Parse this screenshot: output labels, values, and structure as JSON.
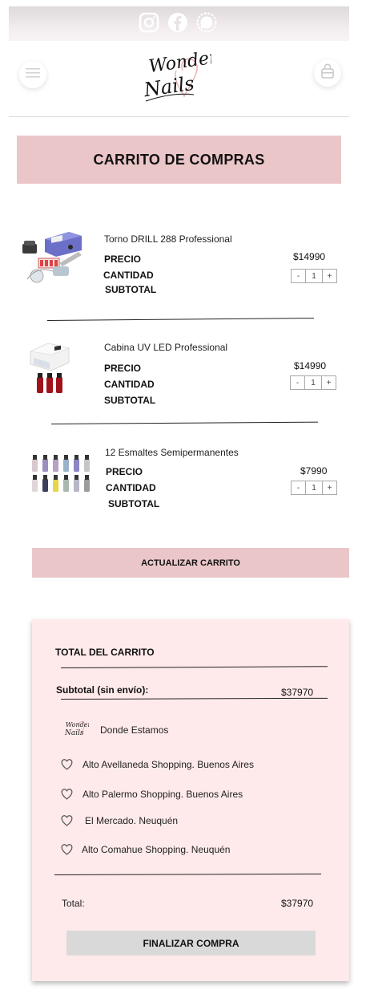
{
  "social": {
    "icons": [
      "instagram-icon",
      "facebook-icon",
      "signal-icon"
    ],
    "bar_color": "#ded9da"
  },
  "header": {
    "logo_line1": "Wonder",
    "logo_line2": "Nails",
    "menu_icon": "hamburger-icon",
    "cart_icon": "shopping-bag-icon"
  },
  "page_title": "CARRITO DE COMPRAS",
  "labels": {
    "price": "PRECIO",
    "quantity": "CANTIDAD",
    "subtotal": "SUBTOTAL",
    "minus": "-",
    "plus": "+"
  },
  "products": [
    {
      "name": "Torno DRILL 288 Professional",
      "price": "$14990",
      "quantity": "1"
    },
    {
      "name": "Cabina UV LED Professional",
      "price": "$14990",
      "quantity": "1"
    },
    {
      "name": "12 Esmaltes Semipermanentes",
      "price": "$7990",
      "quantity": "1"
    }
  ],
  "update_button": "ACTUALIZAR CARRITO",
  "cart_total": {
    "title": "TOTAL DEL CARRITO",
    "subtotal_label": "Subtotal (sin envío):",
    "subtotal_value": "$37970",
    "stores_title": "Donde Estamos",
    "stores": [
      "Alto Avellaneda Shopping. Buenos Aires",
      "Alto Palermo Shopping. Buenos Aires",
      "El Mercado. Neuquén",
      "Alto Comahue Shopping. Neuquén"
    ],
    "total_label": "Total:",
    "total_value": "$37970",
    "checkout_button": "FINALIZAR COMPRA"
  },
  "colors": {
    "accent_pink": "#ebc6c8",
    "card_bg": "#ffeaeb",
    "checkout_gray": "#d9d9d9"
  }
}
